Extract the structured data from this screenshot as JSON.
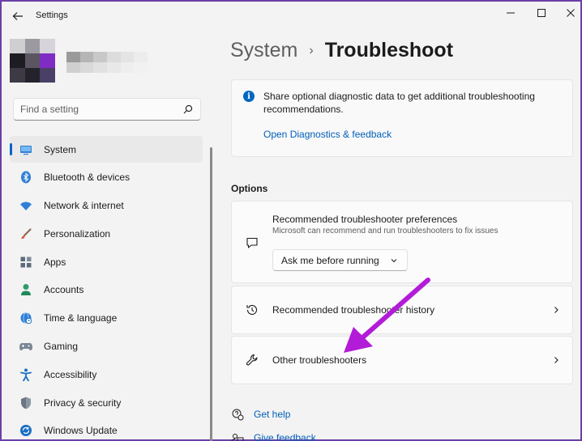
{
  "window": {
    "title": "Settings"
  },
  "search": {
    "placeholder": "Find a setting"
  },
  "sidebar": {
    "items": [
      {
        "label": "System",
        "icon": "monitor-icon",
        "active": true
      },
      {
        "label": "Bluetooth & devices",
        "icon": "bluetooth-icon"
      },
      {
        "label": "Network & internet",
        "icon": "wifi-icon"
      },
      {
        "label": "Personalization",
        "icon": "brush-icon"
      },
      {
        "label": "Apps",
        "icon": "apps-icon"
      },
      {
        "label": "Accounts",
        "icon": "person-icon"
      },
      {
        "label": "Time & language",
        "icon": "globe-clock-icon"
      },
      {
        "label": "Gaming",
        "icon": "gamepad-icon"
      },
      {
        "label": "Accessibility",
        "icon": "accessibility-icon"
      },
      {
        "label": "Privacy & security",
        "icon": "shield-icon"
      },
      {
        "label": "Windows Update",
        "icon": "update-icon"
      }
    ]
  },
  "breadcrumb": {
    "parent": "System",
    "separator": "›",
    "current": "Troubleshoot"
  },
  "info_card": {
    "text": "Share optional diagnostic data to get additional troubleshooting recommendations.",
    "link": "Open Diagnostics & feedback"
  },
  "options": {
    "label": "Options",
    "preferences": {
      "title": "Recommended troubleshooter preferences",
      "subtitle": "Microsoft can recommend and run troubleshooters to fix issues",
      "dropdown_value": "Ask me before running"
    },
    "history": {
      "title": "Recommended troubleshooter history"
    },
    "other": {
      "title": "Other troubleshooters"
    }
  },
  "footer": {
    "get_help": "Get help",
    "give_feedback": "Give feedback"
  },
  "colors": {
    "accent": "#0067c0",
    "link": "#005fb8",
    "annotation_arrow": "#b21bd8"
  }
}
